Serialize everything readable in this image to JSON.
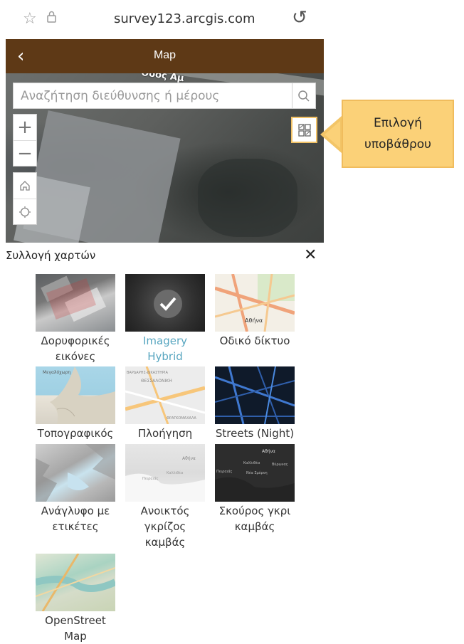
{
  "browser": {
    "url": "survey123.arcgis.com"
  },
  "header": {
    "title": "Map"
  },
  "map": {
    "street_label": "Οδός Αμ",
    "search_placeholder": "Αναζήτηση διεύθυνσης ή μέρους",
    "zoom_in": "+",
    "zoom_out": "−"
  },
  "callout": {
    "line1": "Επιλογή",
    "line2": "υποβάθρου"
  },
  "gallery": {
    "title": "Συλλογή χαρτών",
    "close": "✕",
    "items": [
      {
        "label": "Δορυφορικές εικόνες",
        "selected": false
      },
      {
        "label": "Imagery Hybrid",
        "selected": true
      },
      {
        "label": "Οδικό δίκτυο",
        "selected": false
      },
      {
        "label": "Τοπογραφικός",
        "selected": false
      },
      {
        "label": "Πλοήγηση",
        "selected": false
      },
      {
        "label": "Streets (Night)",
        "selected": false
      },
      {
        "label": "Ανάγλυφο με ετικέτες",
        "selected": false
      },
      {
        "label": "Ανοικτός γκρίζος καμβάς",
        "selected": false
      },
      {
        "label": "Σκούρος γκρι καμβάς",
        "selected": false
      },
      {
        "label": "OpenStreetMap",
        "selected": false
      }
    ],
    "thumb_texts": {
      "streets": "Αθήνα",
      "nav_1": "ΒΑΡΔΑΡΗΣ-ΔΙΚΑΣΤΗΡΙΑ",
      "nav_2": "ΘΕΣΣΑΛΟΝΙΚΗ",
      "nav_3": "ΦΡΑΓΚΟΜΑΧΑΛΑ",
      "topo": "Μεγαλόχωρη",
      "gray_1": "Αθήνα",
      "gray_2": "Καλλιθέα",
      "gray_3": "Πειραιάς",
      "dark_1": "Αθήνα",
      "dark_2": "Καλλιθέα",
      "dark_3": "Πειραιάς",
      "dark_4": "Νέα Σμύρνη",
      "dark_5": "Βύρωνας"
    }
  },
  "colors": {
    "header_bg": "#5e3916",
    "callout_bg": "#fbd178",
    "selected_label": "#58a6c0"
  }
}
